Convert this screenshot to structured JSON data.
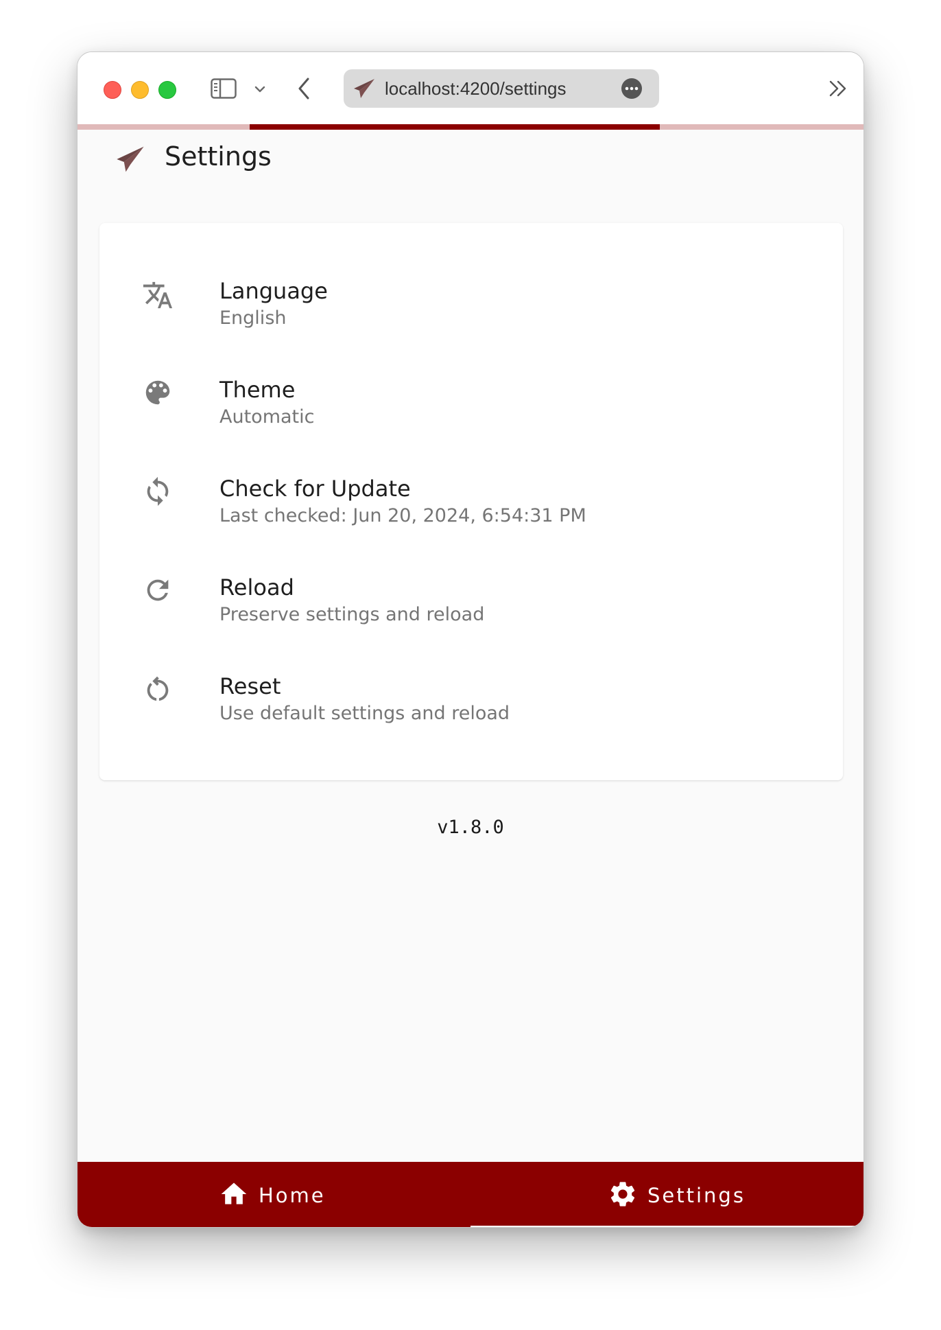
{
  "browser": {
    "url": "localhost:4200/settings",
    "accent_color": "#8b0000",
    "progress_fraction": 0.52
  },
  "header": {
    "title": "Settings"
  },
  "settings": [
    {
      "icon": "translate-icon",
      "title": "Language",
      "subtitle": "English"
    },
    {
      "icon": "palette-icon",
      "title": "Theme",
      "subtitle": "Automatic"
    },
    {
      "icon": "sync-icon",
      "title": "Check for Update",
      "subtitle": "Last checked: Jun 20, 2024, 6:54:31 PM"
    },
    {
      "icon": "refresh-icon",
      "title": "Reload",
      "subtitle": "Preserve settings and reload"
    },
    {
      "icon": "restart-icon",
      "title": "Reset",
      "subtitle": "Use default settings and reload"
    }
  ],
  "version": "v1.8.0",
  "bottom_nav": {
    "home_label": "Home",
    "settings_label": "Settings",
    "active": "Settings"
  }
}
